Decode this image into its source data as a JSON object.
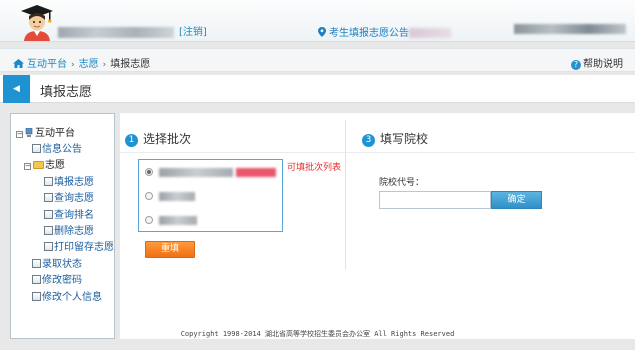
{
  "header": {
    "logout_label": "[注销]",
    "notice_label": "考生填报志愿公告",
    "accent": "#1f93d1"
  },
  "breadcrumb": {
    "items": [
      "互动平台",
      "志愿",
      "填报志愿"
    ],
    "help_label": "帮助说明"
  },
  "page": {
    "title": "填报志愿",
    "back_icon": "triangle-left-icon"
  },
  "sidebar": {
    "root": "互动平台",
    "items": [
      "信息公告",
      "志愿",
      "填报志愿",
      "查询志愿",
      "查询排名",
      "删除志愿",
      "打印留存志愿",
      "录取状态",
      "修改密码",
      "修改个人信息"
    ]
  },
  "batch_section": {
    "step": "1",
    "title": "选择批次",
    "note": "可填批次列表",
    "refill_label": "重填"
  },
  "school_section": {
    "step": "3",
    "title": "填写院校",
    "code_label": "院校代号：",
    "code_value": "",
    "confirm_label": "确定"
  },
  "footer": {
    "text": "Copyright 1998-2014 湖北省高等学校招生委员会办公室 All Rights Reserved"
  }
}
